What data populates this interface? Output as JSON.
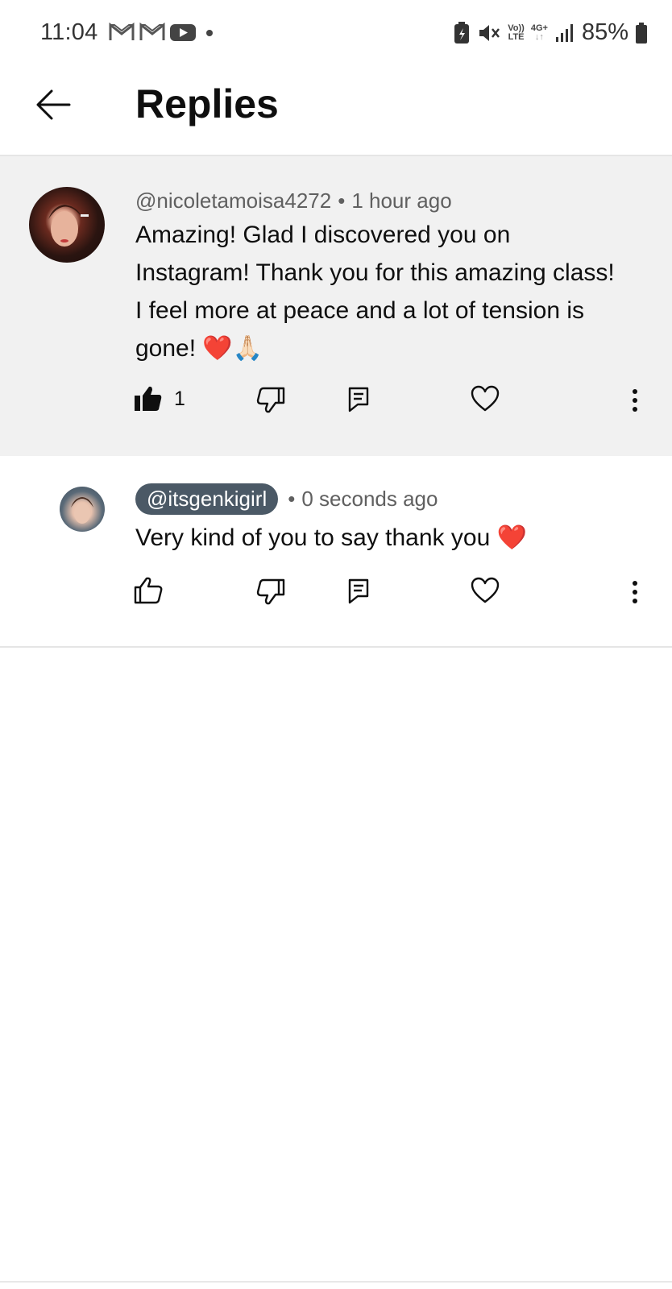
{
  "status_bar": {
    "time": "11:04",
    "net_top": "Vo))",
    "net_bottom": "LTE",
    "gen_top": "4G+",
    "gen_bottom": "↓↑",
    "battery": "85%"
  },
  "header": {
    "title": "Replies"
  },
  "parent_comment": {
    "author": "@nicoletamoisa4272",
    "separator": "•",
    "time": "1 hour ago",
    "text": "Amazing! Glad I discovered you on Instagram! Thank you for this amazing class! I feel more at peace and a lot of tension is gone! ❤️🙏🏻",
    "like_count": "1",
    "liked": true
  },
  "reply_comment": {
    "author": "@itsgenkigirl",
    "separator": "•",
    "time": "0 seconds ago",
    "text": "Very kind of you to say thank you ❤️",
    "liked": false
  },
  "icons": {
    "back": "arrow-left-icon",
    "like": "thumbs-up-icon",
    "dislike": "thumbs-down-icon",
    "reply": "reply-icon",
    "heart": "heart-icon",
    "more": "more-vertical-icon"
  },
  "colors": {
    "parent_bg": "#f1f1f1",
    "handle_badge": "#4b5966",
    "meta_text": "#606060"
  }
}
